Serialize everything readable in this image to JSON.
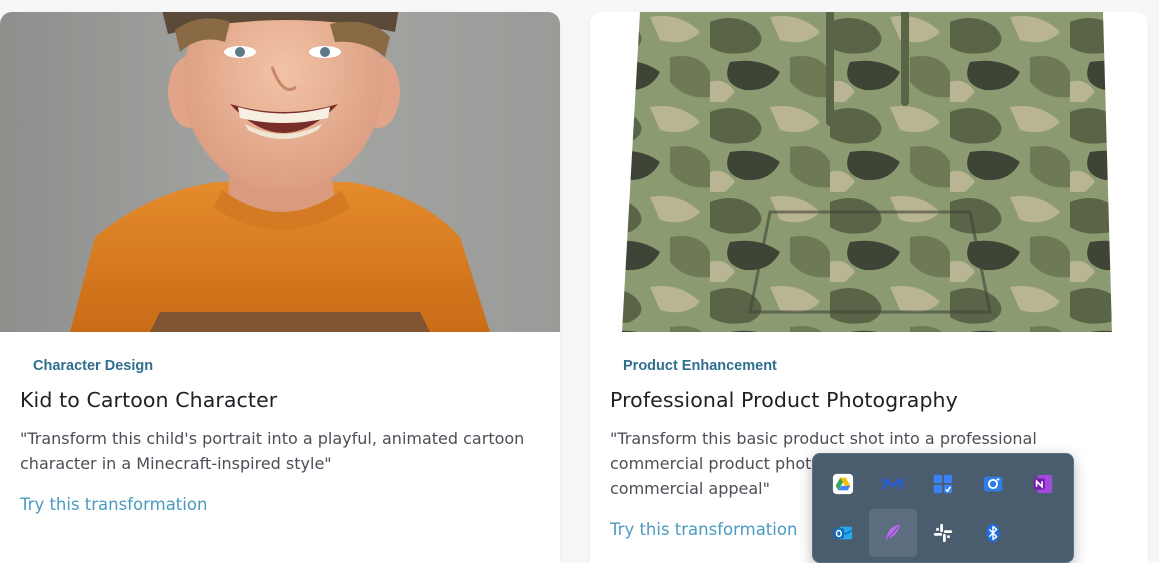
{
  "cards": [
    {
      "image": "smiling-boy-orange-shirt",
      "tag": "Character Design",
      "title": "Kid to Cartoon Character",
      "description": "\"Transform this child's portrait into a playful, animated cartoon character in a Minecraft-inspired style\"",
      "link": "Try this transformation"
    },
    {
      "image": "camo-hoodie",
      "tag": "Product Enhancement",
      "title": "Professional Product Photography",
      "description": "\"Transform this basic product shot into a professional commercial product photograph with ideal lighting and commercial appeal\"",
      "link": "Try this transformation"
    }
  ],
  "tray": {
    "items": [
      {
        "icon": "google-drive-icon"
      },
      {
        "icon": "gmail-client-icon"
      },
      {
        "icon": "tasks-app-icon"
      },
      {
        "icon": "camera-app-icon"
      },
      {
        "icon": "onenote-icon"
      },
      {
        "icon": "outlook-icon"
      },
      {
        "icon": "feather-app-icon",
        "active": true
      },
      {
        "icon": "slack-icon"
      },
      {
        "icon": "bluetooth-icon"
      }
    ]
  },
  "colors": {
    "tag": "#2f6f8e",
    "link": "#4a9ac0",
    "tray_bg": "#4a5d6e"
  }
}
